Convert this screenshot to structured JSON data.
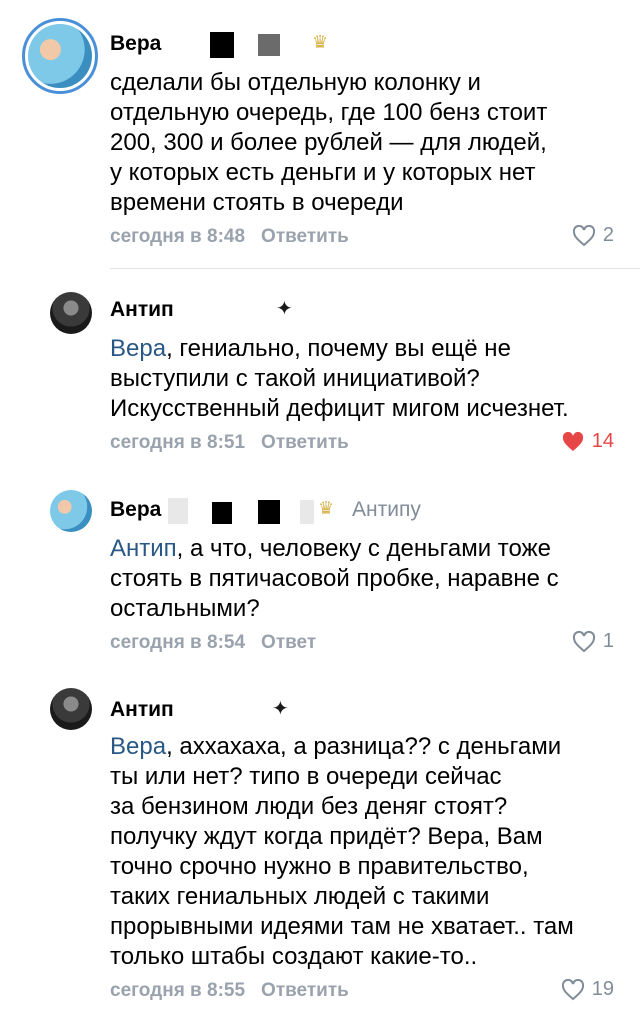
{
  "comments": [
    {
      "author": "Вера",
      "reply_to": "",
      "text_lines": [
        "сделали бы отдельную колонку и",
        "отдельную очередь, где 100 бенз стоит",
        "200, 300 и более рублей — для людей,",
        "у которых есть деньги и у которых нет",
        "времени стоять в очереди"
      ],
      "time": "сегодня в 8:48",
      "reply_label": "Ответить",
      "likes": "2",
      "liked": false
    },
    {
      "author": "Антип",
      "mention": "Вера",
      "text_first": ", гениально, почему вы ещё не",
      "text_lines": [
        "выступили с такой инициативой?",
        "Искусственный дефицит мигом исчезнет."
      ],
      "time": "сегодня в 8:51",
      "reply_label": "Ответить",
      "likes": "14",
      "liked": true
    },
    {
      "author": "Вера",
      "reply_to": "Антипу",
      "mention": "Антип",
      "text_first": ", а что, человеку с деньгами тоже",
      "text_lines": [
        "стоять в пятичасовой пробке, наравне с",
        "остальными?"
      ],
      "time": "сегодня в 8:54",
      "reply_label": "Ответ",
      "likes": "1",
      "liked": false
    },
    {
      "author": "Антип",
      "mention": "Вера",
      "text_first": ", аххахаха, а разница?? с деньгами",
      "text_lines": [
        "ты или нет? типо в очереди сейчас",
        "за бензином люди без деняг стоят?",
        "получку ждут когда придёт? Вера, Вам",
        "точно срочно нужно в правительство,",
        "таких гениальных людей с такими",
        "прорывными идеями там не хватает.. там",
        "только штабы создают какие-то.."
      ],
      "time": "сегодня в 8:55",
      "reply_label": "Ответить",
      "likes": "19",
      "liked": false
    }
  ],
  "icons": {
    "heart": "heart-icon",
    "crown": "crown-icon",
    "dragon": "dragon-icon"
  },
  "colors": {
    "link": "#2a5885",
    "meta": "#99a2ad",
    "liked": "#e64646"
  }
}
